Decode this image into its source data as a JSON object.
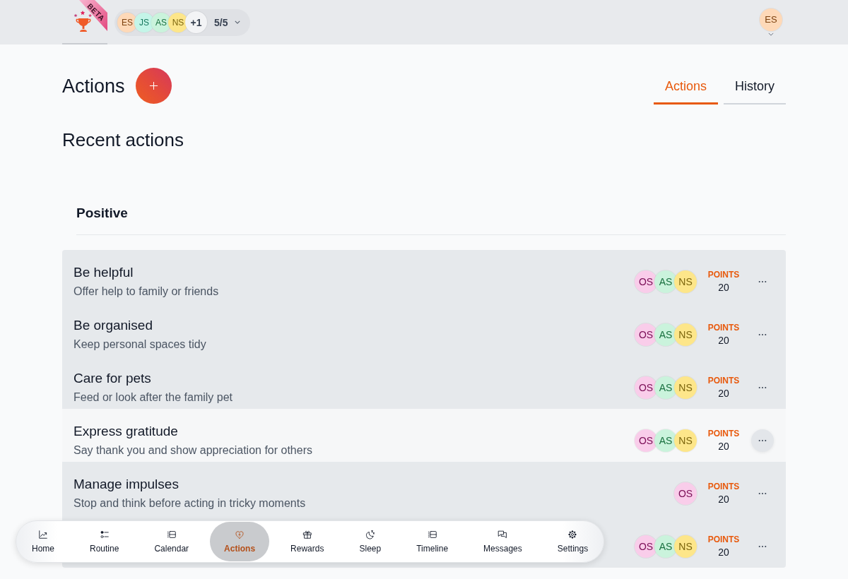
{
  "top_bar": {
    "logo": {
      "badge": "BETA"
    },
    "members": [
      {
        "initials": "ES",
        "color": "#fed9b8"
      },
      {
        "initials": "JS",
        "color": "#c4f5e8"
      },
      {
        "initials": "AS",
        "color": "#caf3dc"
      },
      {
        "initials": "NS",
        "color": "#fde68a"
      }
    ],
    "more_members": "+1",
    "member_count": "5/5",
    "user": {
      "initials": "ES",
      "color": "#fed9b8"
    }
  },
  "page": {
    "title": "Actions",
    "tabs": [
      {
        "label": "Actions",
        "selected": true
      },
      {
        "label": "History",
        "selected": false
      }
    ],
    "subtitle": "Recent actions"
  },
  "section": {
    "title": "Positive",
    "actions": [
      {
        "title": "Be helpful",
        "description": "Offer help to family or friends",
        "members": [
          {
            "initials": "OS",
            "color": "#f9cdea"
          },
          {
            "initials": "AS",
            "color": "#caf3dc"
          },
          {
            "initials": "NS",
            "color": "#fde68a"
          }
        ],
        "points_label": "POINTS",
        "points": "20",
        "hovered": false
      },
      {
        "title": "Be organised",
        "description": "Keep personal spaces tidy",
        "members": [
          {
            "initials": "OS",
            "color": "#f9cdea"
          },
          {
            "initials": "AS",
            "color": "#caf3dc"
          },
          {
            "initials": "NS",
            "color": "#fde68a"
          }
        ],
        "points_label": "POINTS",
        "points": "20",
        "hovered": false
      },
      {
        "title": "Care for pets",
        "description": "Feed or look after the family pet",
        "members": [
          {
            "initials": "OS",
            "color": "#f9cdea"
          },
          {
            "initials": "AS",
            "color": "#caf3dc"
          },
          {
            "initials": "NS",
            "color": "#fde68a"
          }
        ],
        "points_label": "POINTS",
        "points": "20",
        "hovered": false
      },
      {
        "title": "Express gratitude",
        "description": "Say thank you and show appreciation for others",
        "members": [
          {
            "initials": "OS",
            "color": "#f9cdea"
          },
          {
            "initials": "AS",
            "color": "#caf3dc"
          },
          {
            "initials": "NS",
            "color": "#fde68a"
          }
        ],
        "points_label": "POINTS",
        "points": "20",
        "hovered": true
      },
      {
        "title": "Manage impulses",
        "description": "Stop and think before acting in tricky moments",
        "members": [
          {
            "initials": "OS",
            "color": "#f9cdea"
          }
        ],
        "points_label": "POINTS",
        "points": "20",
        "hovered": false
      },
      {
        "members": [
          {
            "initials": "OS",
            "color": "#f9cdea"
          },
          {
            "initials": "AS",
            "color": "#caf3dc"
          },
          {
            "initials": "NS",
            "color": "#fde68a"
          }
        ],
        "points_label": "POINTS",
        "points": "20",
        "hovered": false
      }
    ]
  },
  "bottom_nav": [
    {
      "label": "Home",
      "selected": false
    },
    {
      "label": "Routine",
      "selected": false
    },
    {
      "label": "Calendar",
      "selected": false
    },
    {
      "label": "Actions",
      "selected": true
    },
    {
      "label": "Rewards",
      "selected": false
    },
    {
      "label": "Sleep",
      "selected": false
    },
    {
      "label": "Timeline",
      "selected": false
    },
    {
      "label": "Messages",
      "selected": false
    },
    {
      "label": "Settings",
      "selected": false
    }
  ]
}
